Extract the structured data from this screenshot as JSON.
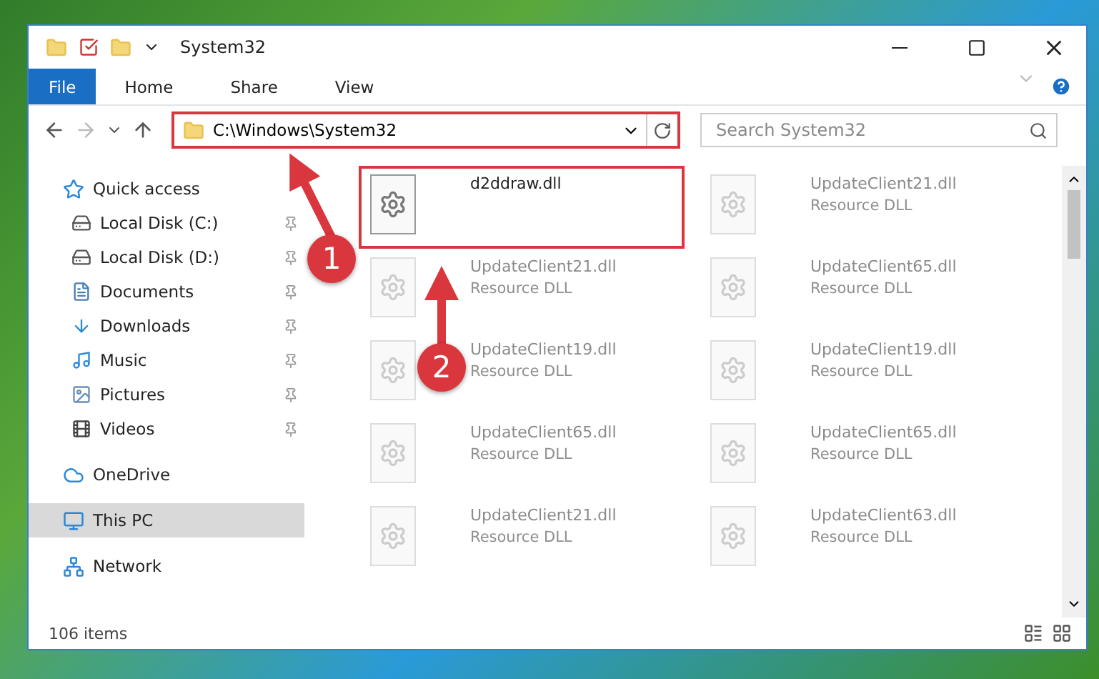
{
  "window": {
    "title": "System32"
  },
  "ribbon": {
    "tabs": [
      {
        "label": "File",
        "kind": "file"
      },
      {
        "label": "Home",
        "kind": "tab"
      },
      {
        "label": "Share",
        "kind": "tab"
      },
      {
        "label": "View",
        "kind": "tab"
      }
    ]
  },
  "address_bar": {
    "path": "C:\\Windows\\System32",
    "search": {
      "placeholder": "Search System32"
    }
  },
  "sidebar": {
    "items": [
      {
        "label": "Quick access",
        "selected": false,
        "children": [
          {
            "label": "Local Disk (C:)",
            "pinned": true
          },
          {
            "label": "Local Disk (D:)",
            "pinned": true
          },
          {
            "label": "Documents",
            "pinned": true
          },
          {
            "label": "Downloads",
            "pinned": true
          },
          {
            "label": "Music",
            "pinned": true
          },
          {
            "label": "Pictures",
            "pinned": true
          },
          {
            "label": "Videos",
            "pinned": true
          }
        ]
      },
      {
        "label": "OneDrive",
        "selected": false
      },
      {
        "label": "This PC",
        "selected": true
      },
      {
        "label": "Network",
        "selected": false
      }
    ]
  },
  "files": [
    {
      "name": "d2ddraw.dll",
      "faded": false,
      "highlighted": true
    },
    {
      "name": "UpdateClient21.dll",
      "type": "Resource DLL",
      "faded": true,
      "highlighted": false
    },
    {
      "name": "UpdateClient21.dll",
      "type": "Resource DLL",
      "faded": true,
      "highlighted": false
    },
    {
      "name": "UpdateClient65.dll",
      "type": "Resource DLL",
      "faded": true,
      "highlighted": false
    },
    {
      "name": "UpdateClient19.dll",
      "type": "Resource DLL",
      "faded": true,
      "highlighted": false
    },
    {
      "name": "UpdateClient19.dll",
      "type": "Resource DLL",
      "faded": true,
      "highlighted": false
    },
    {
      "name": "UpdateClient65.dll",
      "type": "Resource DLL",
      "faded": true,
      "highlighted": false
    },
    {
      "name": "UpdateClient65.dll",
      "type": "Resource DLL",
      "faded": true,
      "highlighted": false
    },
    {
      "name": "UpdateClient21.dll",
      "type": "Resource DLL",
      "faded": true,
      "highlighted": false
    },
    {
      "name": "UpdateClient63.dll",
      "type": "Resource DLL",
      "faded": true,
      "highlighted": false
    }
  ],
  "annotations": [
    {
      "label": "1"
    },
    {
      "label": "2"
    }
  ],
  "status_bar": {
    "count": "106 items"
  }
}
